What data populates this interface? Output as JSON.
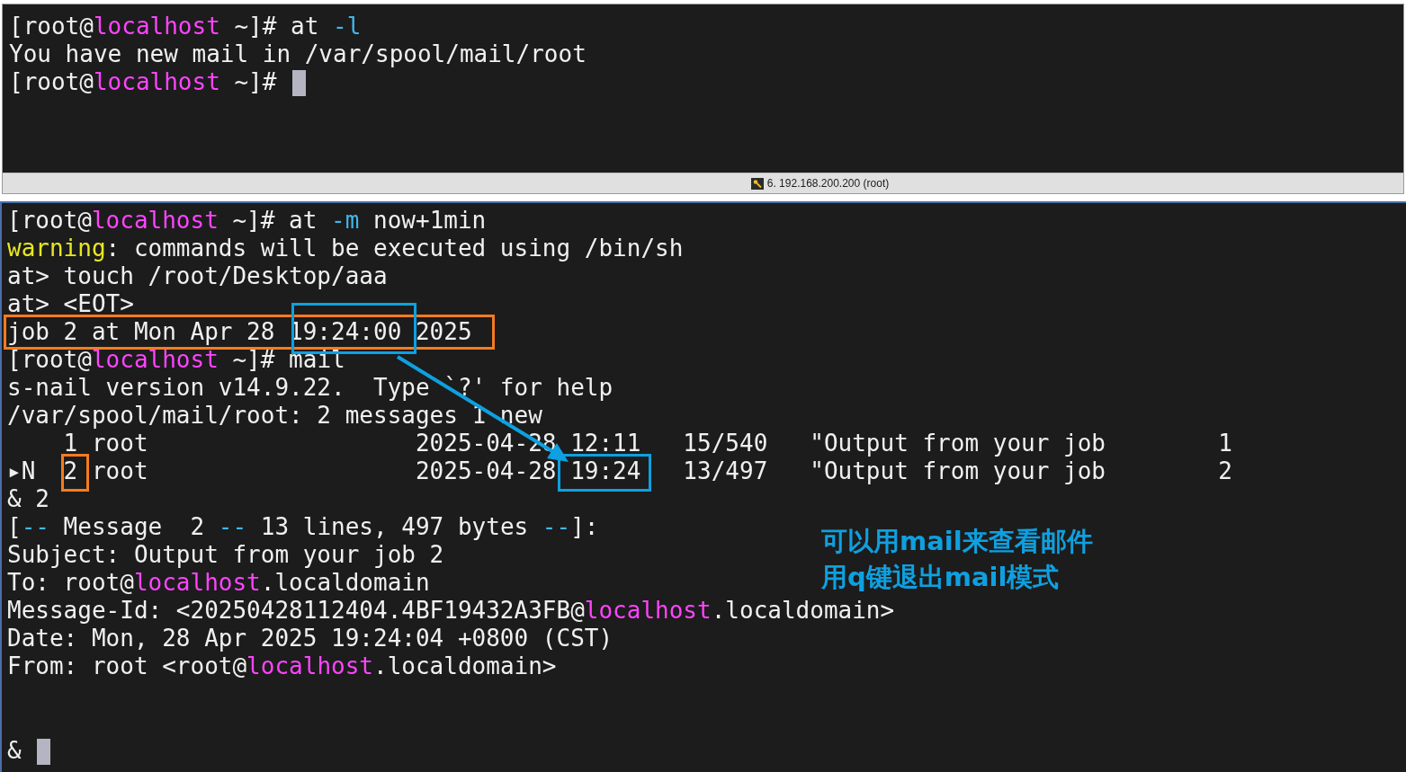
{
  "top_pane": {
    "lines": [
      {
        "segments": [
          {
            "kind": "plain",
            "text": "[root@"
          },
          {
            "kind": "host",
            "text": "localhost"
          },
          {
            "kind": "plain",
            "text": " ~]# at "
          },
          {
            "kind": "option",
            "text": "-l"
          }
        ]
      },
      {
        "segments": [
          {
            "kind": "plain",
            "text": "You have new mail in /var/spool/mail/root"
          }
        ]
      }
    ],
    "input_line": {
      "segments": [
        {
          "kind": "plain",
          "text": "[root@"
        },
        {
          "kind": "host",
          "text": "localhost"
        },
        {
          "kind": "plain",
          "text": " ~]# "
        }
      ],
      "cursor": true
    }
  },
  "tab_strip": {
    "label": "6. 192.168.200.200 (root)"
  },
  "bottom_pane": {
    "lines": [
      {
        "segments": [
          {
            "kind": "plain",
            "text": "[root@"
          },
          {
            "kind": "host",
            "text": "localhost"
          },
          {
            "kind": "plain",
            "text": " ~]# at "
          },
          {
            "kind": "option",
            "text": "-m"
          },
          {
            "kind": "plain",
            "text": " now+1min"
          }
        ]
      },
      {
        "segments": [
          {
            "kind": "warning",
            "text": "warning"
          },
          {
            "kind": "plain",
            "text": ": commands will be executed using /bin/sh"
          }
        ]
      },
      {
        "segments": [
          {
            "kind": "plain",
            "text": "at> touch /root/Desktop/aaa"
          }
        ]
      },
      {
        "segments": [
          {
            "kind": "plain",
            "text": "at> <EOT>"
          }
        ]
      },
      {
        "segments": [
          {
            "kind": "plain",
            "text": "job 2 at Mon Apr 28 19:24:00 2025"
          }
        ]
      },
      {
        "segments": [
          {
            "kind": "plain",
            "text": "[root@"
          },
          {
            "kind": "host",
            "text": "localhost"
          },
          {
            "kind": "plain",
            "text": " ~]# mail"
          }
        ]
      },
      {
        "segments": [
          {
            "kind": "plain",
            "text": "s-nail version v14.9.22.  Type `?' for help"
          }
        ]
      },
      {
        "segments": [
          {
            "kind": "plain",
            "text": "/var/spool/mail/root: 2 messages 1 new"
          }
        ]
      },
      {
        "segments": [
          {
            "kind": "plain",
            "text": "    1 root                   2025-04-28 12:11   15/540   \"Output from your job        1"
          }
        ]
      },
      {
        "segments": [
          {
            "kind": "plain",
            "text": "▸N  2 root                   2025-04-28 19:24   13/497   \"Output from your job        2"
          }
        ]
      },
      {
        "segments": [
          {
            "kind": "plain",
            "text": "& 2"
          }
        ]
      },
      {
        "segments": [
          {
            "kind": "plain",
            "text": "["
          },
          {
            "kind": "option",
            "text": "--"
          },
          {
            "kind": "plain",
            "text": " Message  2 "
          },
          {
            "kind": "option",
            "text": "--"
          },
          {
            "kind": "plain",
            "text": " 13 lines, 497 bytes "
          },
          {
            "kind": "option",
            "text": "--"
          },
          {
            "kind": "plain",
            "text": "]:"
          }
        ]
      },
      {
        "segments": [
          {
            "kind": "plain",
            "text": "Subject: Output from your job 2"
          }
        ]
      },
      {
        "segments": [
          {
            "kind": "plain",
            "text": "To: root@"
          },
          {
            "kind": "host",
            "text": "localhost"
          },
          {
            "kind": "plain",
            "text": ".localdomain"
          }
        ]
      },
      {
        "segments": [
          {
            "kind": "plain",
            "text": "Message-Id: <20250428112404.4BF19432A3FB@"
          },
          {
            "kind": "host",
            "text": "localhost"
          },
          {
            "kind": "plain",
            "text": ".localdomain>"
          }
        ]
      },
      {
        "segments": [
          {
            "kind": "plain",
            "text": "Date: Mon, 28 Apr 2025 19:24:04 +0800 (CST)"
          }
        ]
      },
      {
        "segments": [
          {
            "kind": "plain",
            "text": "From: root <root@"
          },
          {
            "kind": "host",
            "text": "localhost"
          },
          {
            "kind": "plain",
            "text": ".localdomain>"
          }
        ]
      }
    ],
    "input_line": {
      "segments": [
        {
          "kind": "plain",
          "text": "& "
        }
      ],
      "cursor": true
    }
  },
  "annotations": {
    "boxes": [
      {
        "color": "#f57c1f"
      },
      {
        "color": "#0ea0e0"
      },
      {
        "color": "#f57c1f"
      },
      {
        "color": "#0ea0e0"
      }
    ],
    "note": [
      "可以用mail来查看邮件",
      "用q键退出mail模式"
    ]
  }
}
